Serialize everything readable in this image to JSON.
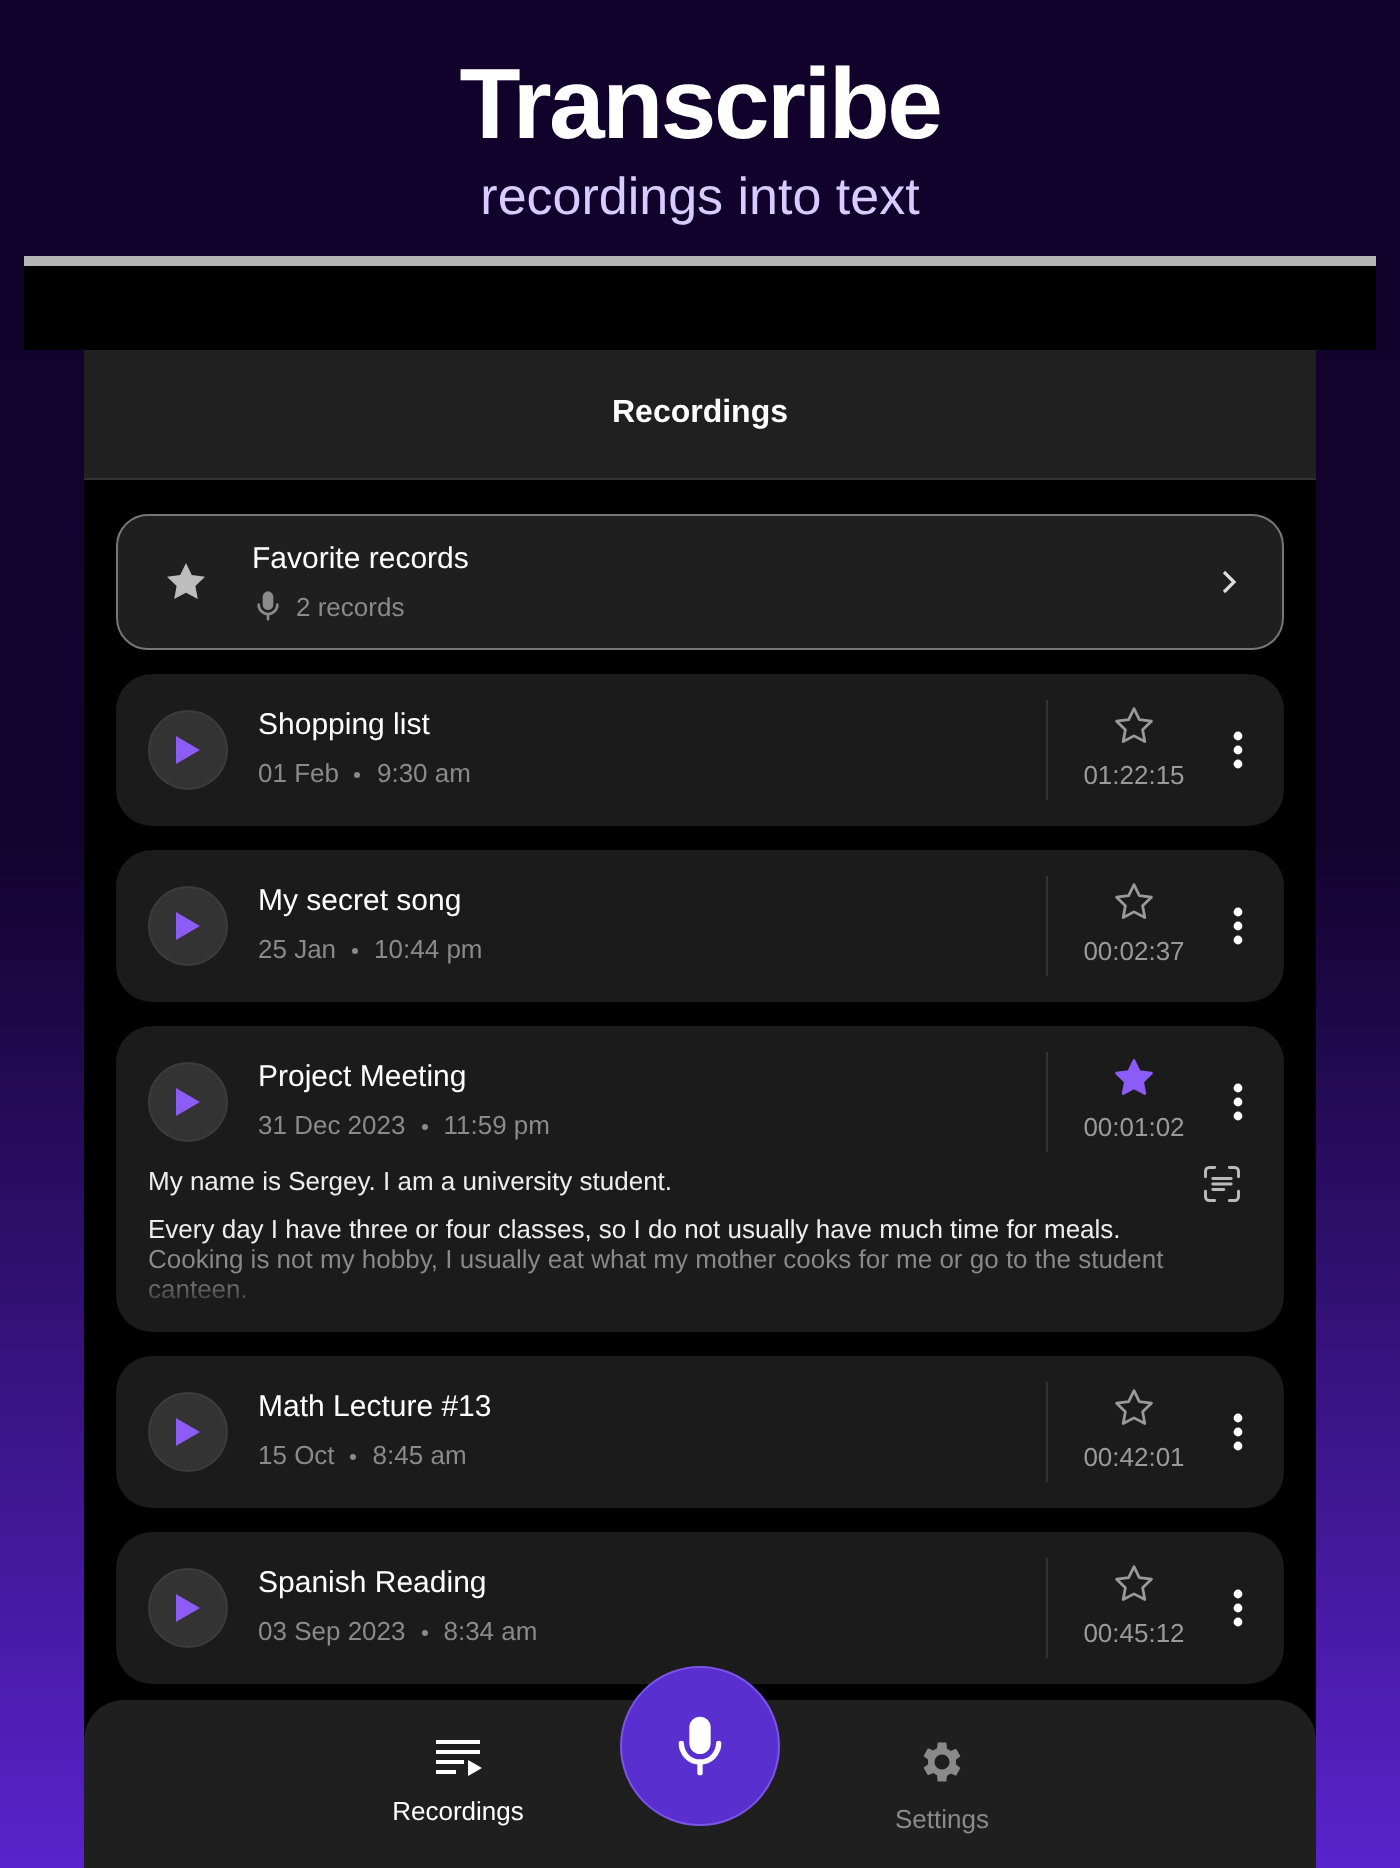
{
  "promo": {
    "title": "Transcribe",
    "subtitle": "recordings into text"
  },
  "header": {
    "title": "Recordings"
  },
  "favorites": {
    "title": "Favorite records",
    "count": "2 records"
  },
  "recordings": [
    {
      "title": "Shopping list",
      "date": "01 Feb",
      "time": "9:30 am",
      "duration": "01:22:15",
      "favorite": false
    },
    {
      "title": "My secret song",
      "date": "25 Jan",
      "time": "10:44 pm",
      "duration": "00:02:37",
      "favorite": false
    },
    {
      "title": "Project Meeting",
      "date": "31 Dec 2023",
      "time": "11:59 pm",
      "duration": "00:01:02",
      "favorite": true,
      "transcript": [
        "My name is Sergey. I am a university student.",
        "Every day I have three or four classes, so I do not usually have much time for meals.",
        "Cooking is not my hobby, I usually eat what my mother cooks for me or go to the student canteen."
      ]
    },
    {
      "title": "Math Lecture #13",
      "date": "15 Oct",
      "time": "8:45 am",
      "duration": "00:42:01",
      "favorite": false
    },
    {
      "title": "Spanish Reading",
      "date": "03 Sep 2023",
      "time": "8:34 am",
      "duration": "00:45:12",
      "favorite": false
    }
  ],
  "nav": [
    {
      "kind": "recordings",
      "label": "Recordings",
      "selected": true
    },
    {
      "kind": "record"
    },
    {
      "kind": "settings",
      "label": "Settings",
      "selected": false
    }
  ]
}
